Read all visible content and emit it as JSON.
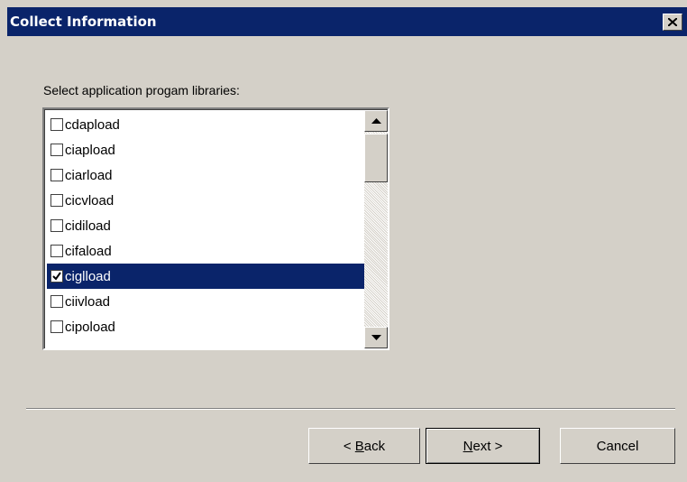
{
  "window": {
    "title": "Collect Information",
    "close_label": "Close"
  },
  "prompt": "Select application progam libraries:",
  "libraries": [
    {
      "name": "cdapload",
      "checked": false,
      "selected": false
    },
    {
      "name": "ciapload",
      "checked": false,
      "selected": false
    },
    {
      "name": "ciarload",
      "checked": false,
      "selected": false
    },
    {
      "name": "cicvload",
      "checked": false,
      "selected": false
    },
    {
      "name": "cidiload",
      "checked": false,
      "selected": false
    },
    {
      "name": "cifaload",
      "checked": false,
      "selected": false
    },
    {
      "name": "ciglload",
      "checked": true,
      "selected": true
    },
    {
      "name": "ciivload",
      "checked": false,
      "selected": false
    },
    {
      "name": "cipoload",
      "checked": false,
      "selected": false
    }
  ],
  "buttons": {
    "back": {
      "prefix": "< ",
      "mnemonic": "B",
      "rest": "ack"
    },
    "next": {
      "mnemonic": "N",
      "rest": "ext >"
    },
    "cancel": "Cancel"
  },
  "colors": {
    "titlebar": "#0a246a",
    "selection": "#0a246a",
    "face": "#d4d0c8"
  },
  "icons": {
    "close": "close-x-icon",
    "scroll_up": "arrow-up-icon",
    "scroll_down": "arrow-down-icon",
    "check": "checkmark-icon"
  }
}
